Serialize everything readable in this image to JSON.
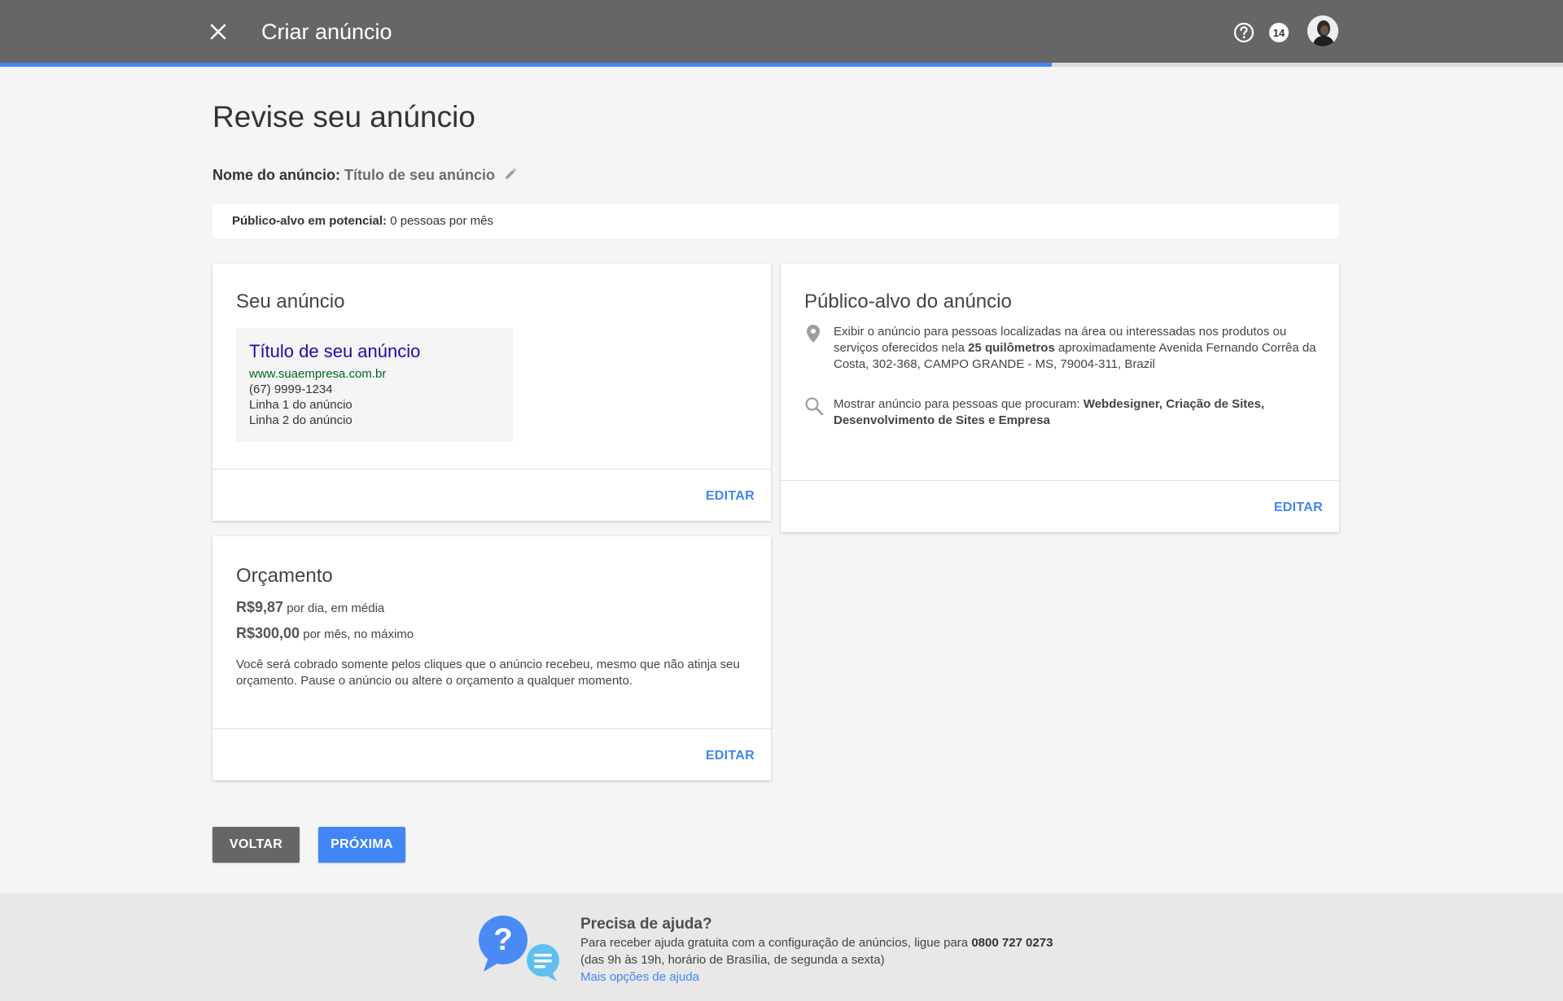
{
  "header": {
    "title": "Criar anúncio",
    "notification_count": "14",
    "progress_fraction": 0.673,
    "icons": [
      "close-icon",
      "help-icon",
      "notification-badge",
      "avatar"
    ]
  },
  "main": {
    "page_title": "Revise seu anúncio",
    "ad_name_label": "Nome do anúncio:",
    "ad_name_value": "Título de seu anúncio",
    "audience_label": "Público-alvo em potencial:",
    "audience_value": "0 pessoas por mês"
  },
  "ad_card": {
    "title": "Seu anúncio",
    "preview": {
      "headline": "Título de seu anúncio",
      "url": "www.suaempresa.com.br",
      "phone": "(67) 9999-1234",
      "line1": "Linha 1 do anúncio",
      "line2": "Linha 2 do anúncio"
    },
    "edit_label": "EDITAR"
  },
  "target_card": {
    "title": "Público-alvo do anúncio",
    "location_text_1": "Exibir o anúncio para pessoas localizadas na área ou interessadas nos produtos ou serviços oferecidos nela ",
    "location_radius": "25 quilômetros",
    "location_text_2": " aproximadamente Avenida Fernando Corrêa da Costa, 302-368, CAMPO GRANDE - MS, 79004-311, Brazil",
    "search_text": "Mostrar anúncio para pessoas que procuram: ",
    "search_keywords": "Webdesigner, Criação de Sites, Desenvolvimento de Sites e Empresa",
    "edit_label": "EDITAR"
  },
  "budget_card": {
    "title": "Orçamento",
    "daily_amount": "R$9,87",
    "daily_text": " por dia, em média",
    "monthly_amount": "R$300,00",
    "monthly_text": " por mês, no máximo",
    "note": "Você será cobrado somente pelos cliques que o anúncio recebeu, mesmo que não atinja seu orçamento. Pause o anúncio ou altere o orçamento a qualquer momento.",
    "edit_label": "EDITAR"
  },
  "actions": {
    "back_label": "VOLTAR",
    "next_label": "PRÓXIMA"
  },
  "footer": {
    "heading": "Precisa de ajuda?",
    "text_1": "Para receber ajuda gratuita com a configuração de anúncios, ligue para ",
    "phone": "0800 727 0273",
    "hours": "(das 9h às 19h, horário de Brasília, de segunda a sexta)",
    "link": "Mais opções de ajuda"
  },
  "colors": {
    "topbar": "#666666",
    "accent": "#4285f4",
    "ad_headline": "#1a0dab",
    "ad_url": "#006621"
  }
}
